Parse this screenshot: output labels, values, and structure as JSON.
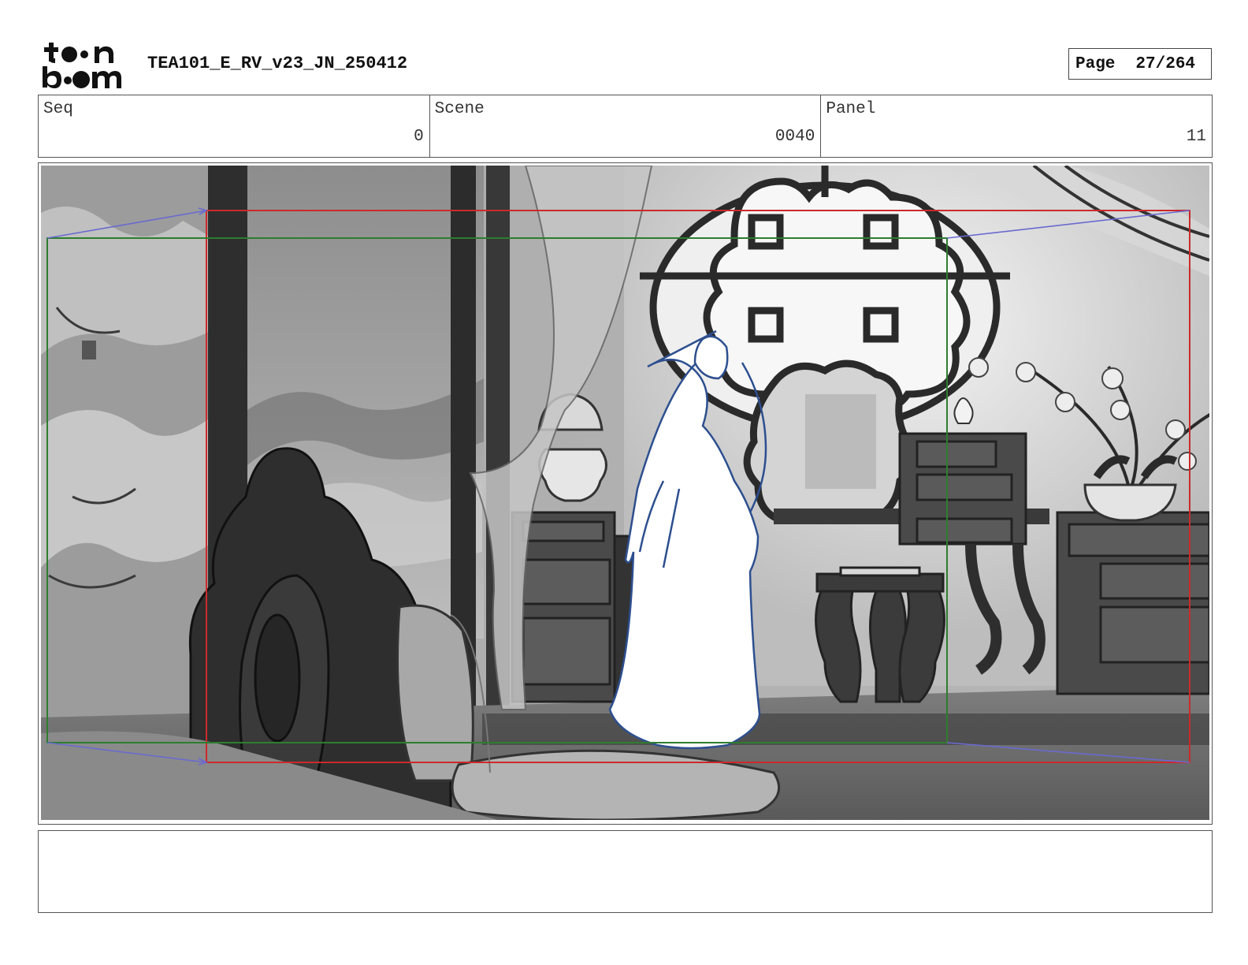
{
  "header": {
    "logo_text": "toon boom",
    "document_title": "TEA101_E_RV_v23_JN_250412",
    "page_label": "Page",
    "page_number": "27/264"
  },
  "info": {
    "seq_label": "Seq",
    "seq_value": "0",
    "scene_label": "Scene",
    "scene_value": "0040",
    "panel_label": "Panel",
    "panel_value": "11"
  },
  "colors": {
    "camera_frame_start": "#cc2a2a",
    "camera_frame_end": "#2e7d2e",
    "camera_path": "#6a6ad0",
    "character_outline": "#2d4f8f"
  },
  "notes": {
    "text": ""
  }
}
